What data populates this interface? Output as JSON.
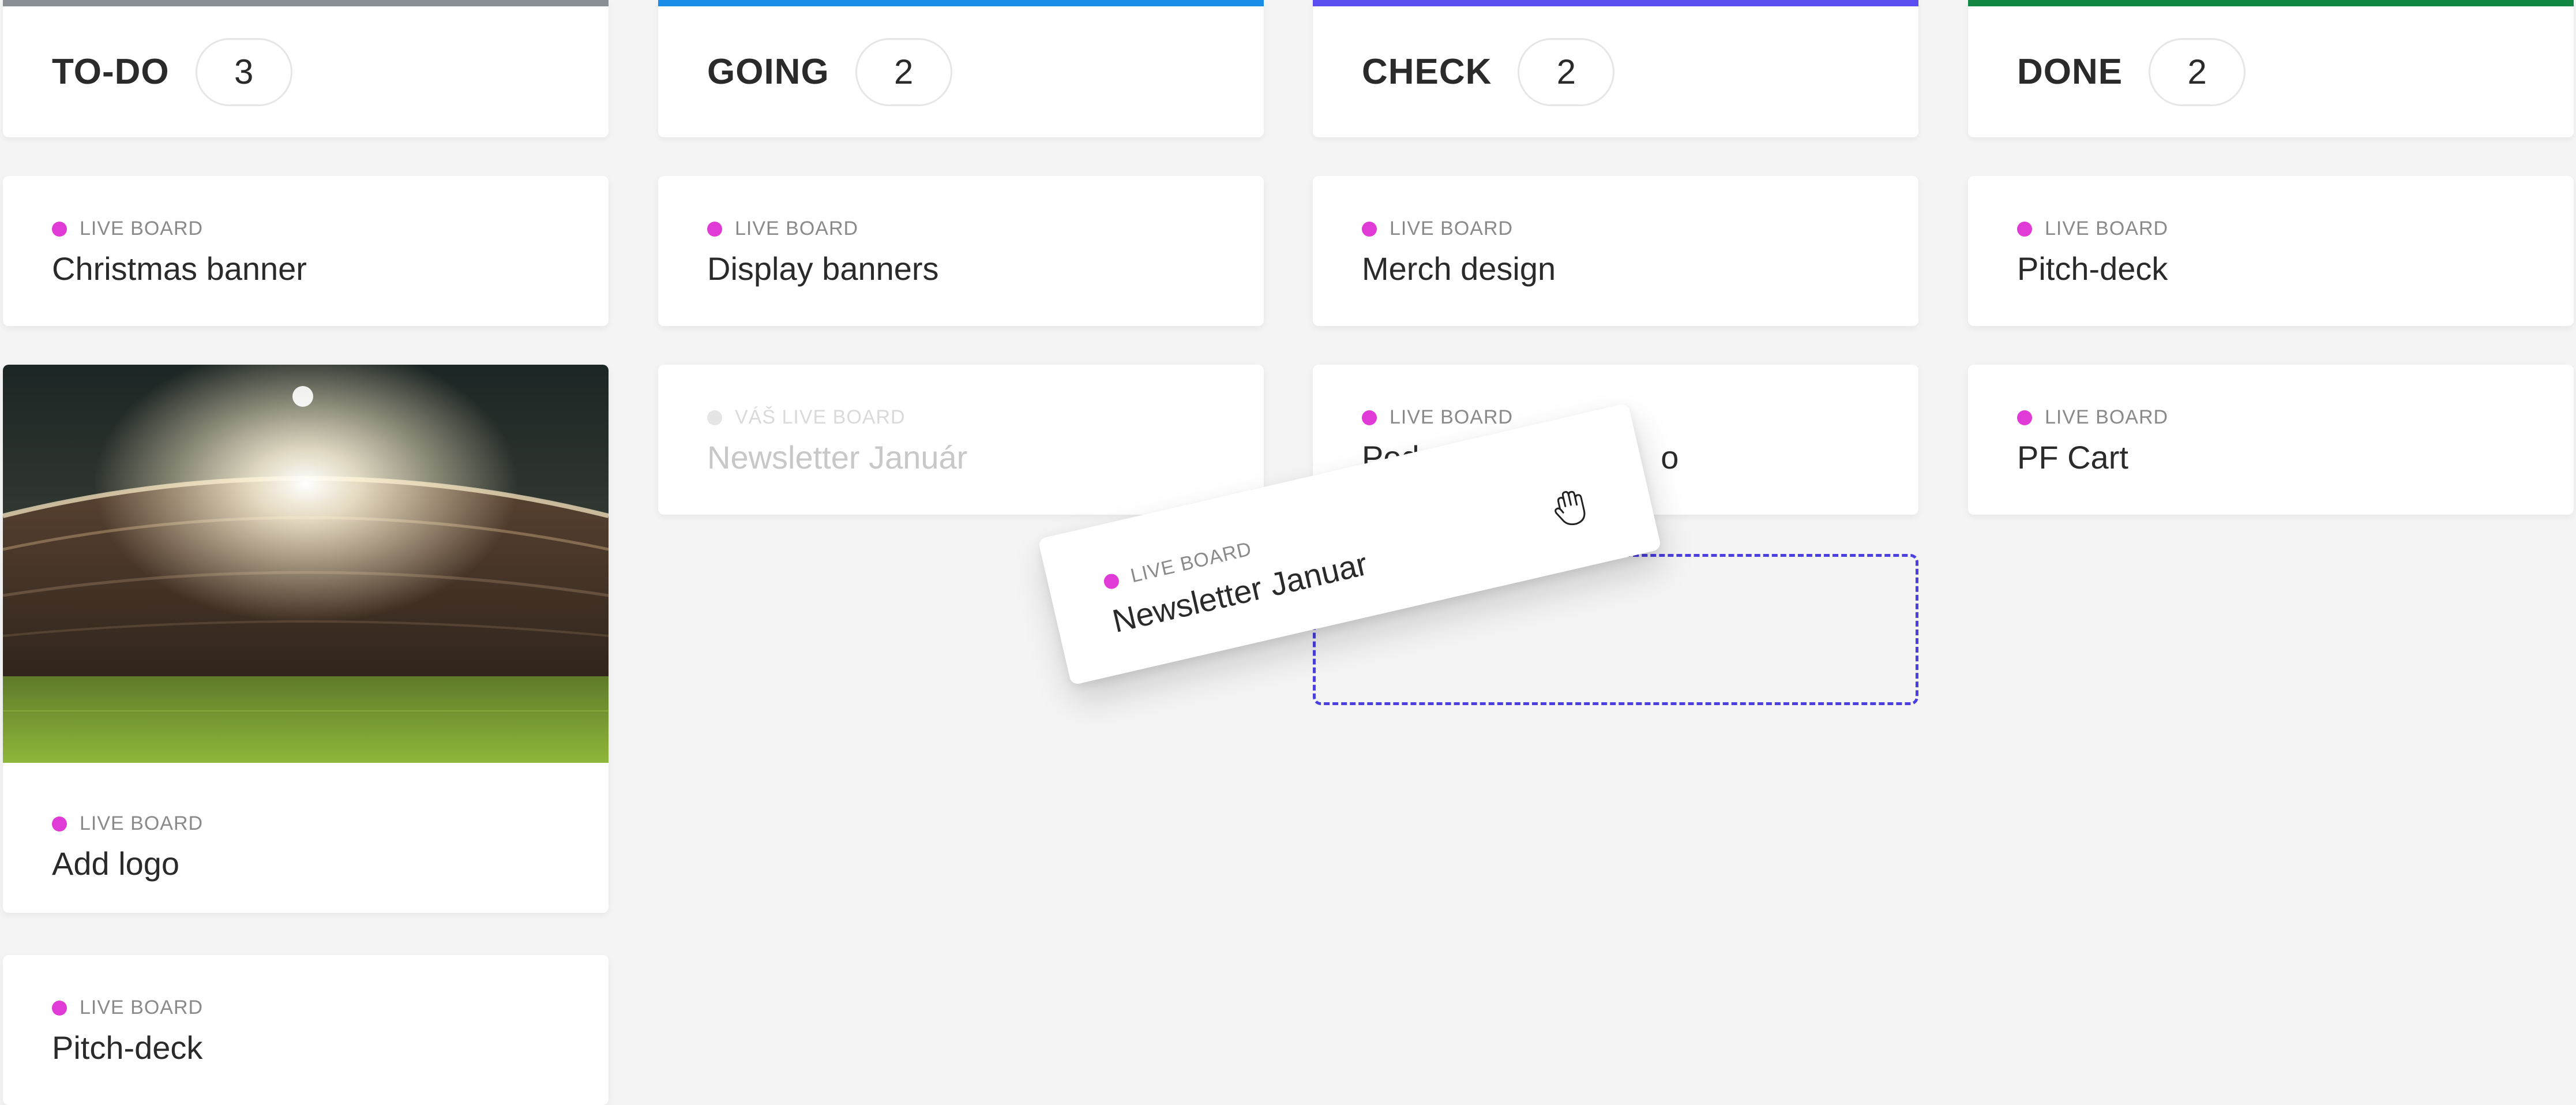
{
  "columns": [
    {
      "title": "TO-DO",
      "count": "3",
      "accent": "#8a8f96",
      "cards": [
        {
          "tag": "LIVE BOARD",
          "title": "Christmas banner"
        },
        {
          "tag": "LIVE BOARD",
          "title": "Add logo",
          "image": "stadium-photo"
        },
        {
          "tag": "LIVE BOARD",
          "title": "Pitch-deck"
        }
      ]
    },
    {
      "title": "GOING",
      "count": "2",
      "accent": "#1a8ee6",
      "cards": [
        {
          "tag": "LIVE BOARD",
          "title": "Display banners"
        },
        {
          "tag": "VÁŠ LIVE BOARD",
          "title": "Newsletter Január",
          "state": "faded"
        }
      ]
    },
    {
      "title": "CHECK",
      "count": "2",
      "accent": "#5b4ef0",
      "cards": [
        {
          "tag": "LIVE BOARD",
          "title": "Merch design"
        },
        {
          "tag": "LIVE BOARD",
          "title_left": "Podst",
          "title_right": "o"
        }
      ]
    },
    {
      "title": "DONE",
      "count": "2",
      "accent": "#128744",
      "cards": [
        {
          "tag": "LIVE BOARD",
          "title": "Pitch-deck"
        },
        {
          "tag": "LIVE BOARD",
          "title": "PF Cart"
        }
      ]
    }
  ],
  "dragging": {
    "tag": "LIVE BOARD",
    "title": "Newsletter Januar",
    "cursor": "grab-hand-icon"
  },
  "colors": {
    "tag_dot": "#e03bd6",
    "drop_target": "#4b3fe0",
    "background": "#f4f4f4"
  }
}
